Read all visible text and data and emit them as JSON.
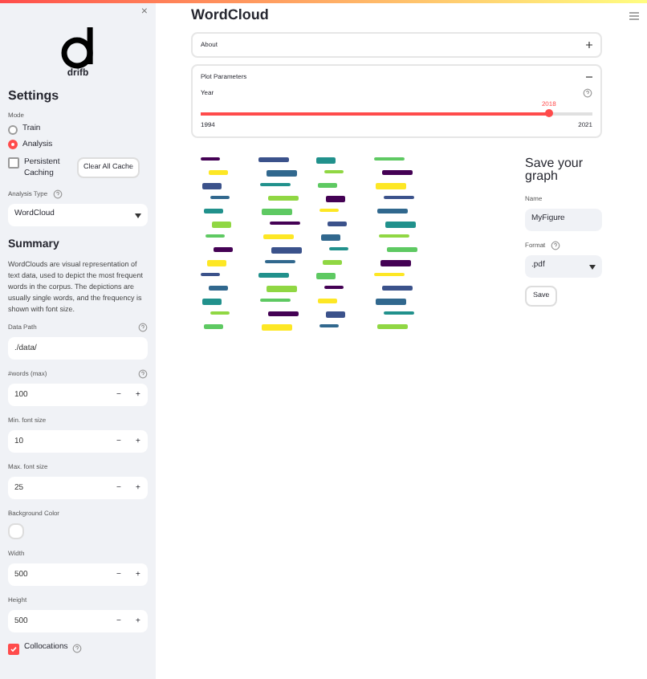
{
  "sidebar": {
    "close": "×",
    "logo_text": "drifb",
    "title": "Settings",
    "mode": {
      "label": "Mode",
      "options": [
        {
          "label": "Train",
          "selected": false
        },
        {
          "label": "Analysis",
          "selected": true
        }
      ]
    },
    "caching": {
      "label": "Persistent Caching",
      "checked": false
    },
    "clear_button": "Clear All Cache",
    "analysis_type": {
      "label": "Analysis Type",
      "value": "WordCloud"
    },
    "summary": {
      "title": "Summary",
      "text": "WordClouds are visual representation of text data, used to depict the most frequent words in the corpus. The depictions are usually single words, and the frequency is shown with font size."
    },
    "fields": [
      {
        "kind": "text",
        "label": "Data Path",
        "value": "./data/",
        "help": true
      },
      {
        "kind": "number",
        "label": "#words (max)",
        "value": "100",
        "help": true,
        "minus": "−",
        "plus": "+"
      },
      {
        "kind": "number",
        "label": "Min. font size",
        "value": "10",
        "help": false,
        "minus": "−",
        "plus": "+"
      },
      {
        "kind": "number",
        "label": "Max. font size",
        "value": "25",
        "help": false,
        "minus": "−",
        "plus": "+"
      },
      {
        "kind": "color",
        "label": "Background Color",
        "color": "#ffffff",
        "help": false
      },
      {
        "kind": "number",
        "label": "Width",
        "value": "500",
        "help": false,
        "minus": "−",
        "plus": "+"
      },
      {
        "kind": "number",
        "label": "Height",
        "value": "500",
        "help": false,
        "minus": "−",
        "plus": "+"
      }
    ],
    "collocations": {
      "label": "Collocations",
      "checked": true
    }
  },
  "main": {
    "title": "WordCloud",
    "expanders": [
      {
        "label": "About",
        "expanded": false
      },
      {
        "label": "Plot Parameters",
        "expanded": true
      }
    ],
    "slider": {
      "label": "Year",
      "value": "2018",
      "min": "1994",
      "max": "2021",
      "level": 0.889
    },
    "save": {
      "title": "Save your graph",
      "name_label": "Name",
      "name_value": "MyFigure",
      "format_label": "Format",
      "format_value": ".pdf",
      "button": "Save"
    }
  }
}
